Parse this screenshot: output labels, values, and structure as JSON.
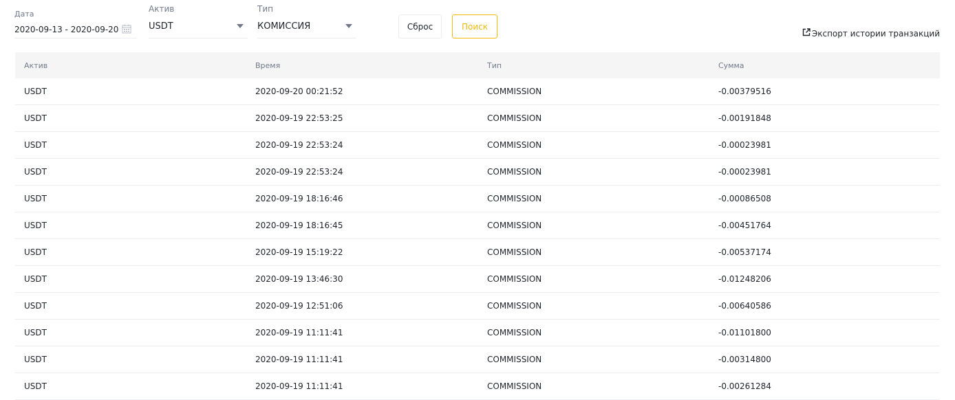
{
  "filters": {
    "date_label": "Дата",
    "date_value": "2020-09-13 - 2020-09-20",
    "asset_label": "Актив",
    "asset_value": "USDT",
    "type_label": "Тип",
    "type_value": "КОМИССИЯ",
    "reset_label": "Сброс",
    "search_label": "Поиск",
    "export_label": "Экспорт истории транзакций"
  },
  "colors": {
    "accent": "#f0b90b",
    "text": "#1e2329",
    "muted": "#707a8a",
    "header_bg": "#f5f5f5"
  },
  "table": {
    "headers": [
      "Актив",
      "Время",
      "Тип",
      "Сумма"
    ],
    "rows": [
      [
        "USDT",
        "2020-09-20 00:21:52",
        "COMMISSION",
        "-0.00379516"
      ],
      [
        "USDT",
        "2020-09-19 22:53:25",
        "COMMISSION",
        "-0.00191848"
      ],
      [
        "USDT",
        "2020-09-19 22:53:24",
        "COMMISSION",
        "-0.00023981"
      ],
      [
        "USDT",
        "2020-09-19 22:53:24",
        "COMMISSION",
        "-0.00023981"
      ],
      [
        "USDT",
        "2020-09-19 18:16:46",
        "COMMISSION",
        "-0.00086508"
      ],
      [
        "USDT",
        "2020-09-19 18:16:45",
        "COMMISSION",
        "-0.00451764"
      ],
      [
        "USDT",
        "2020-09-19 15:19:22",
        "COMMISSION",
        "-0.00537174"
      ],
      [
        "USDT",
        "2020-09-19 13:46:30",
        "COMMISSION",
        "-0.01248206"
      ],
      [
        "USDT",
        "2020-09-19 12:51:06",
        "COMMISSION",
        "-0.00640586"
      ],
      [
        "USDT",
        "2020-09-19 11:11:41",
        "COMMISSION",
        "-0.01101800"
      ],
      [
        "USDT",
        "2020-09-19 11:11:41",
        "COMMISSION",
        "-0.00314800"
      ],
      [
        "USDT",
        "2020-09-19 11:11:41",
        "COMMISSION",
        "-0.00261284"
      ]
    ]
  }
}
